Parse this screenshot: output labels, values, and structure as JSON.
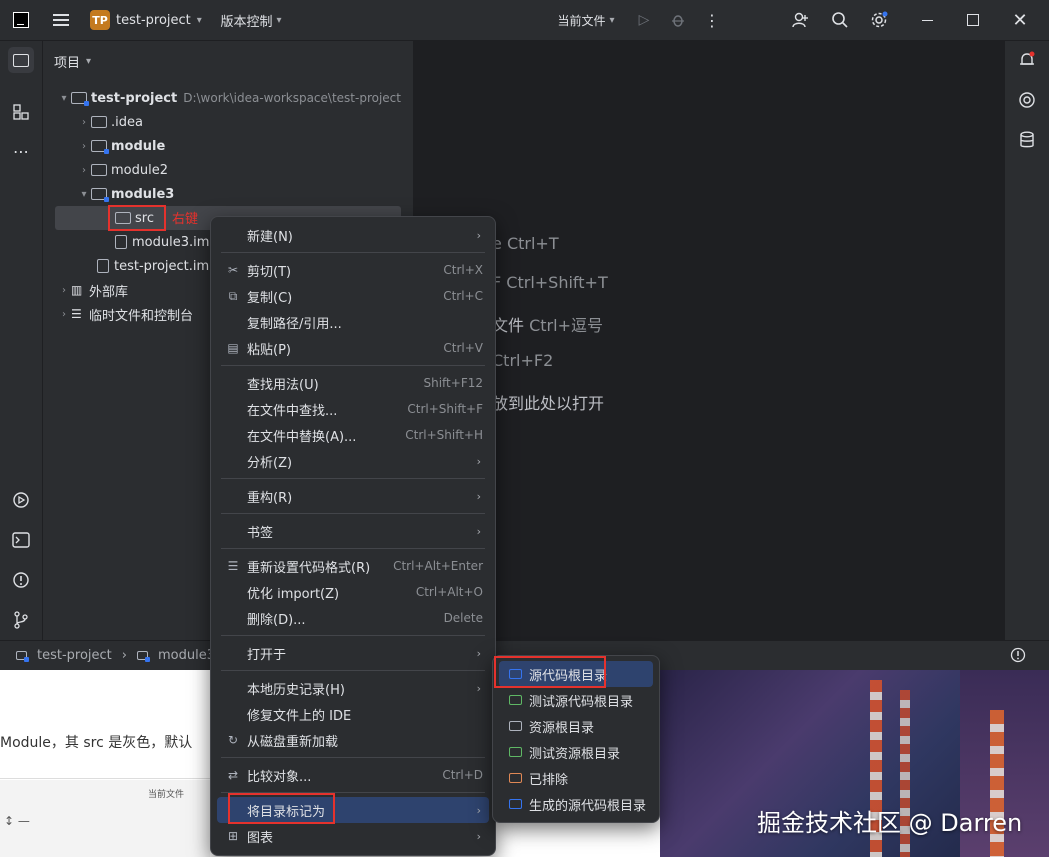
{
  "titlebar": {
    "project_badge": "TP",
    "project_name": "test-project",
    "vcs_label": "版本控制",
    "run_config": "当前文件"
  },
  "project_panel": {
    "title": "项目",
    "root": {
      "name": "test-project",
      "path": "D:\\work\\idea-workspace\\test-project"
    },
    "items": [
      {
        "label": ".idea"
      },
      {
        "label": "module"
      },
      {
        "label": "module2"
      },
      {
        "label": "module3"
      },
      {
        "label": "src"
      },
      {
        "label": "module3.iml"
      },
      {
        "label": "test-project.iml"
      },
      {
        "label": "外部库"
      },
      {
        "label": "临时文件和控制台"
      }
    ],
    "annotation": "右键"
  },
  "editor_hints": [
    {
      "text": "Ctrl+T",
      "prefix": "e"
    },
    {
      "text": "Ctrl+Shift+T",
      "prefix": "F"
    },
    {
      "text": "Ctrl+逗号",
      "prefix": "文件"
    },
    {
      "text": "Ctrl+F2",
      "prefix": ""
    },
    {
      "text": "放到此处以打开",
      "prefix": ""
    }
  ],
  "statusbar": {
    "crumb1": "test-project",
    "crumb2": "module3"
  },
  "context_menu": {
    "items": [
      {
        "label": "新建(N)",
        "shortcut": "",
        "submenu": true,
        "icon": ""
      },
      {
        "label": "剪切(T)",
        "shortcut": "Ctrl+X",
        "icon": "scissors-icon"
      },
      {
        "label": "复制(C)",
        "shortcut": "Ctrl+C",
        "icon": "copy-icon"
      },
      {
        "label": "复制路径/引用...",
        "shortcut": "",
        "icon": ""
      },
      {
        "label": "粘贴(P)",
        "shortcut": "Ctrl+V",
        "icon": "paste-icon"
      },
      {
        "label": "查找用法(U)",
        "shortcut": "Shift+F12"
      },
      {
        "label": "在文件中查找...",
        "shortcut": "Ctrl+Shift+F"
      },
      {
        "label": "在文件中替换(A)...",
        "shortcut": "Ctrl+Shift+H"
      },
      {
        "label": "分析(Z)",
        "submenu": true
      },
      {
        "label": "重构(R)",
        "submenu": true
      },
      {
        "label": "书签",
        "submenu": true
      },
      {
        "label": "重新设置代码格式(R)",
        "shortcut": "Ctrl+Alt+Enter",
        "icon": "format-icon"
      },
      {
        "label": "优化 import(Z)",
        "shortcut": "Ctrl+Alt+O"
      },
      {
        "label": "删除(D)...",
        "shortcut": "Delete"
      },
      {
        "label": "打开于",
        "submenu": true
      },
      {
        "label": "本地历史记录(H)",
        "submenu": true
      },
      {
        "label": "修复文件上的 IDE"
      },
      {
        "label": "从磁盘重新加载",
        "icon": "reload-icon"
      },
      {
        "label": "比较对象...",
        "shortcut": "Ctrl+D",
        "icon": "compare-icon"
      },
      {
        "label": "将目录标记为",
        "submenu": true
      },
      {
        "label": "图表",
        "submenu": true,
        "icon": "diagram-icon"
      }
    ]
  },
  "submenu": {
    "items": [
      {
        "label": "源代码根目录",
        "color": "#3574f0"
      },
      {
        "label": "测试源代码根目录",
        "color": "#5fb865"
      },
      {
        "label": "资源根目录",
        "color": "#aeb3bd"
      },
      {
        "label": "测试资源根目录",
        "color": "#5fb865"
      },
      {
        "label": "已排除",
        "color": "#e08855"
      },
      {
        "label": "生成的源代码根目录",
        "color": "#3574f0"
      }
    ]
  },
  "background_page": {
    "text1": "Module，其 src 是灰色，默认",
    "text2": "当前文件"
  },
  "watermark": "掘金技术社区 @ Darren"
}
